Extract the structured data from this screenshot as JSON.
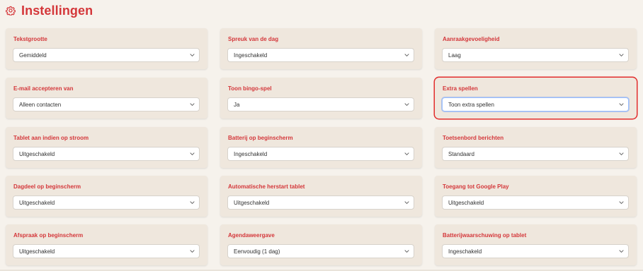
{
  "page": {
    "title": "Instellingen",
    "title_icon": "gear-icon",
    "accent_color": "#d4373a",
    "highlight_color": "#e22d2d"
  },
  "settings": [
    {
      "label": "Tekstgrootte",
      "value": "Gemiddeld"
    },
    {
      "label": "Spreuk van de dag",
      "value": "Ingeschakeld"
    },
    {
      "label": "Aanraakgevoeligheid",
      "value": "Laag"
    },
    {
      "label": "E-mail accepteren van",
      "value": "Alleen contacten"
    },
    {
      "label": "Toon bingo-spel",
      "value": "Ja"
    },
    {
      "label": "Extra spellen",
      "value": "Toon extra spellen",
      "highlighted": true
    },
    {
      "label": "Tablet aan indien op stroom",
      "value": "Uitgeschakeld"
    },
    {
      "label": "Batterij op beginscherm",
      "value": "Ingeschakeld"
    },
    {
      "label": "Toetsenbord berichten",
      "value": "Standaard"
    },
    {
      "label": "Dagdeel op beginscherm",
      "value": "Uitgeschakeld"
    },
    {
      "label": "Automatische herstart tablet",
      "value": "Uitgeschakeld"
    },
    {
      "label": "Toegang tot Google Play",
      "value": "Uitgeschakeld"
    },
    {
      "label": "Afspraak op beginscherm",
      "value": "Uitgeschakeld"
    },
    {
      "label": "Agendaweergave",
      "value": "Eenvoudig (1 dag)"
    },
    {
      "label": "Batterijwaarschuwing op tablet",
      "value": "Ingeschakeld"
    }
  ]
}
